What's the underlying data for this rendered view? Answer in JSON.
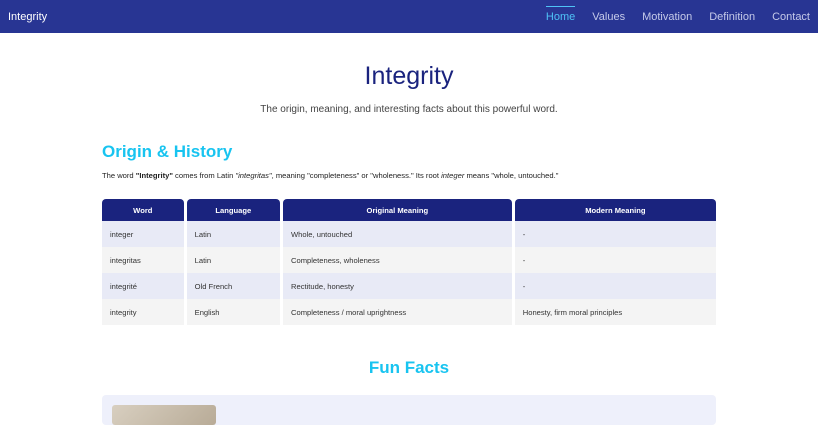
{
  "nav": {
    "brand": "Integrity",
    "links": [
      "Home",
      "Values",
      "Motivation",
      "Definition",
      "Contact"
    ]
  },
  "hero": {
    "title": "Integrity",
    "subtitle": "The origin, meaning, and interesting facts about this powerful word."
  },
  "origin": {
    "heading": "Origin & History",
    "text_1": "The word ",
    "text_word": "\"Integrity\"",
    "text_2": " comes from Latin ",
    "text_latin": "\"integritas\"",
    "text_3": ", meaning \"completeness\" or \"wholeness.\" Its root ",
    "text_root": "integer",
    "text_4": " means \"whole, untouched.\""
  },
  "table": {
    "headers": [
      "Word",
      "Language",
      "Original Meaning",
      "Modern Meaning"
    ],
    "rows": [
      [
        "integer",
        "Latin",
        "Whole, untouched",
        "-"
      ],
      [
        "integritas",
        "Latin",
        "Completeness, wholeness",
        "-"
      ],
      [
        "integrité",
        "Old French",
        "Rectitude, honesty",
        "-"
      ],
      [
        "integrity",
        "English",
        "Completeness / moral uprightness",
        "Honesty, firm moral principles"
      ]
    ]
  },
  "fun_facts": {
    "heading": "Fun Facts"
  }
}
